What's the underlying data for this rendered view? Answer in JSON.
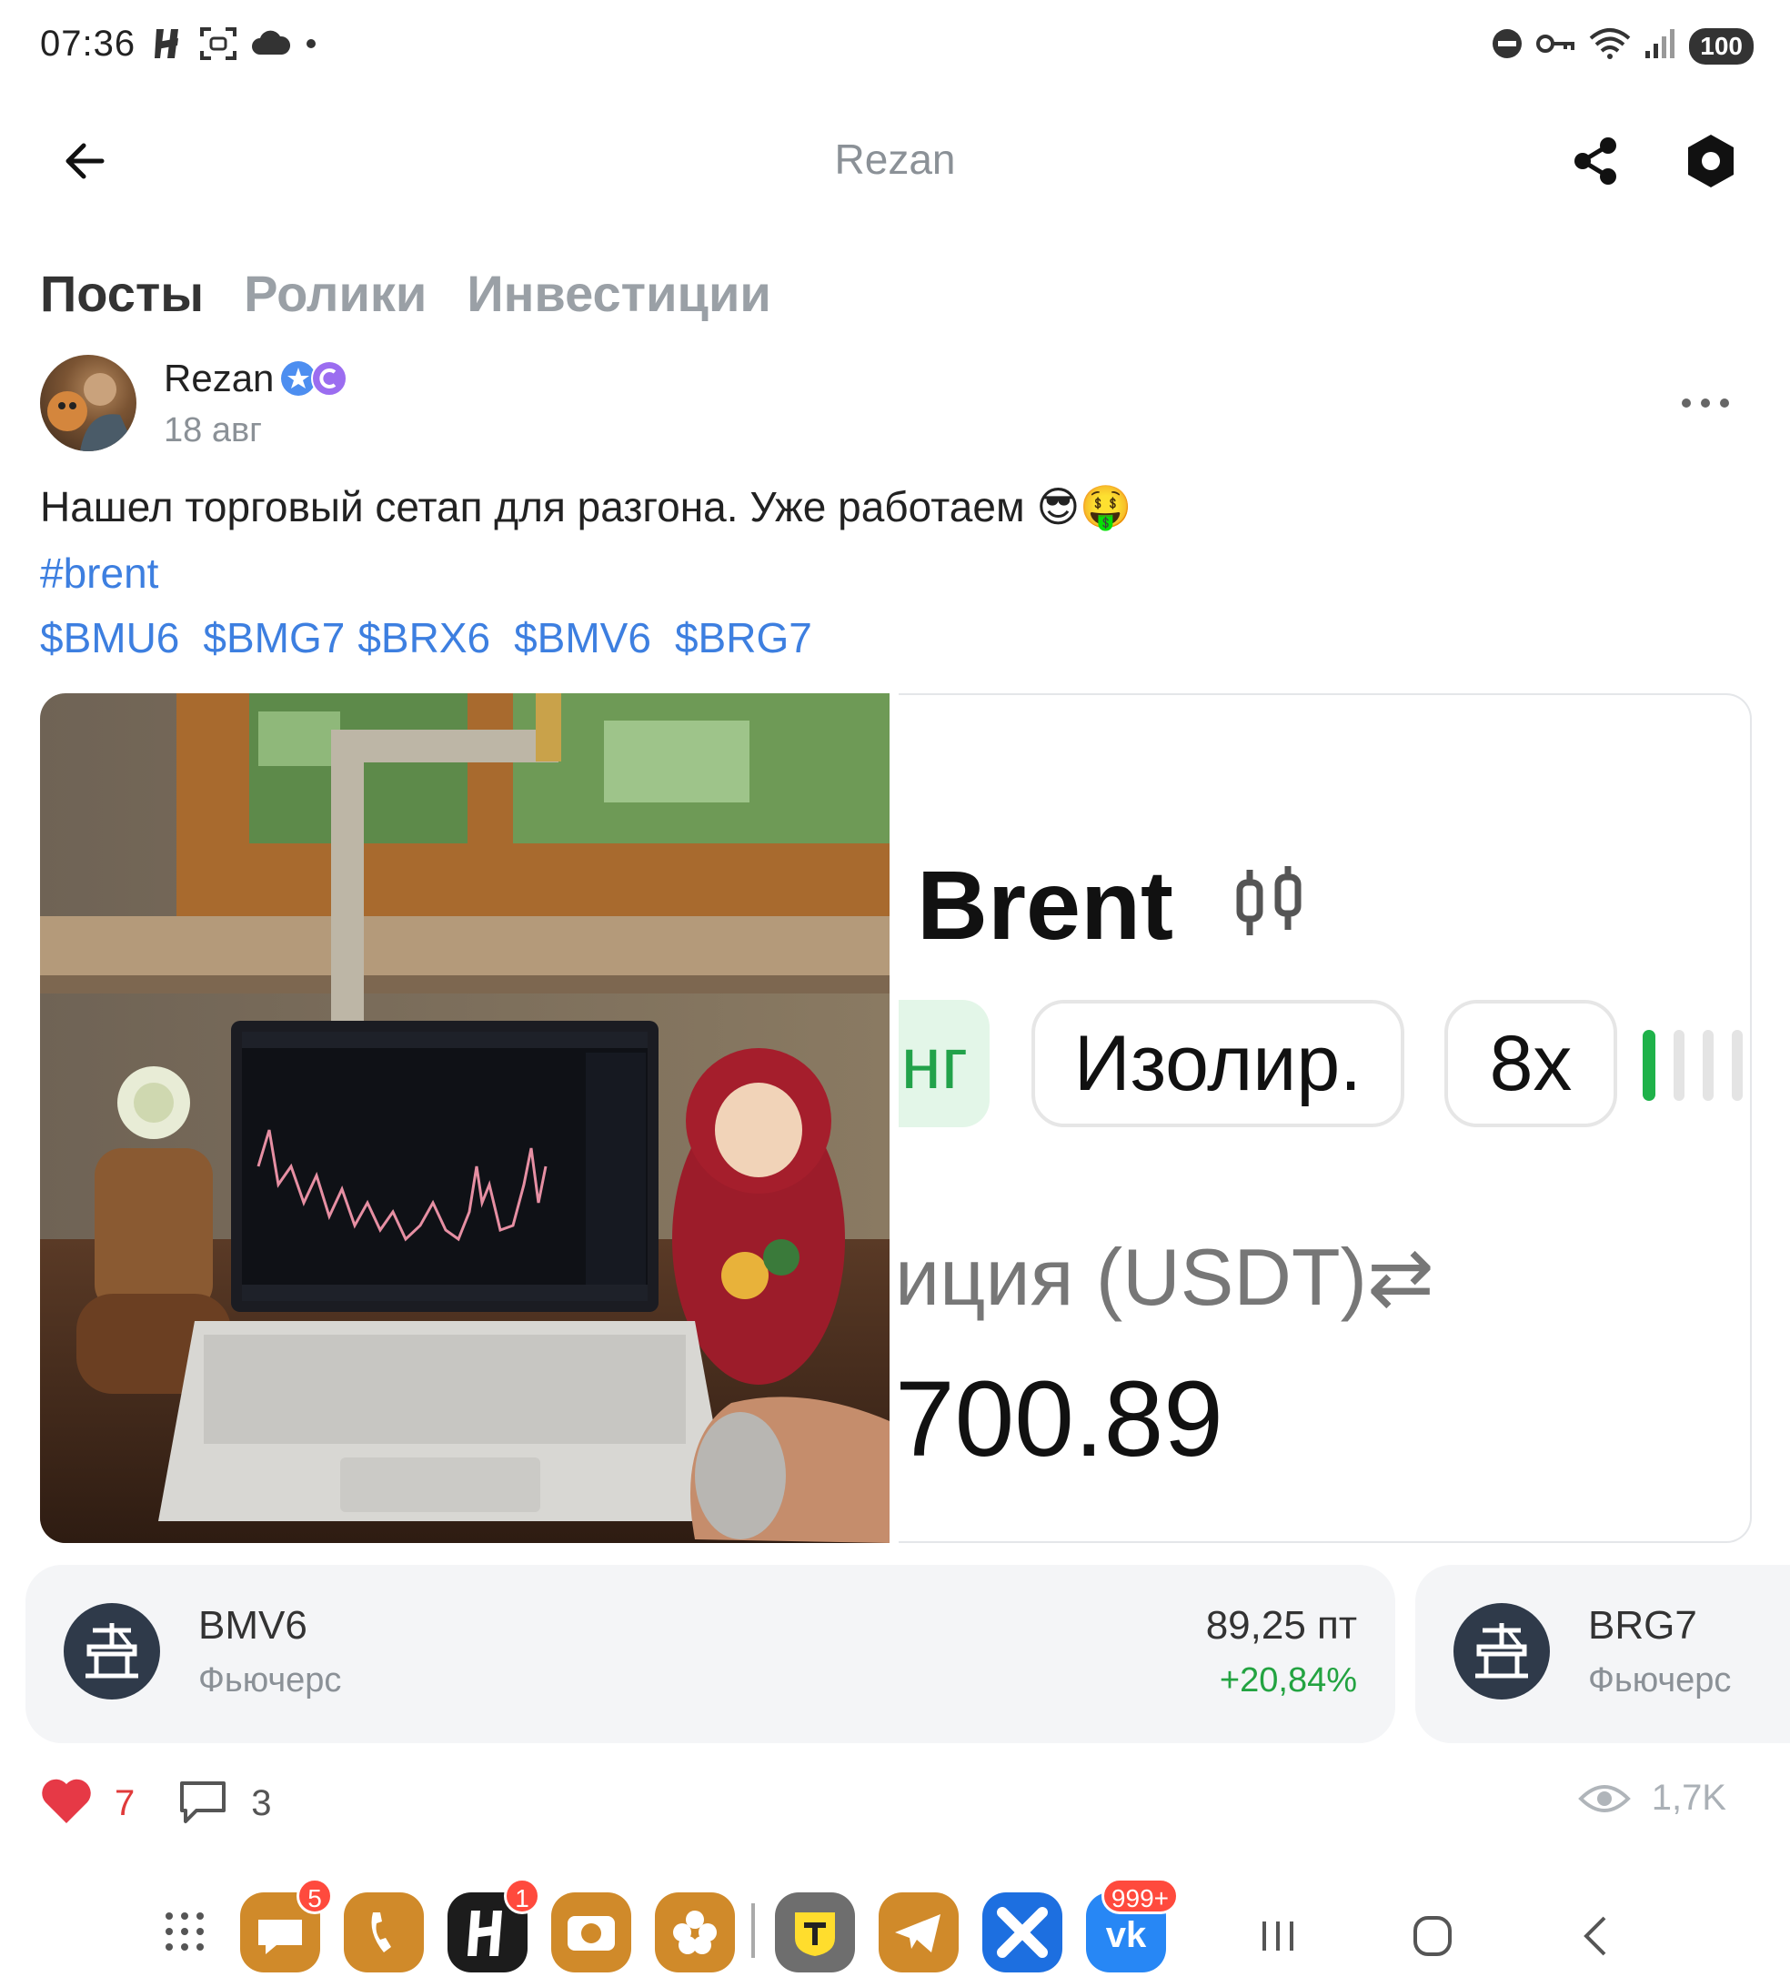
{
  "status_bar": {
    "time": "07:36",
    "battery": "100",
    "left_icons": [
      "hydra-icon",
      "screenshot-icon",
      "cloud-icon",
      "dot-icon"
    ],
    "right_icons": [
      "dnd-icon",
      "key-icon",
      "wifi-icon",
      "signal-icon"
    ]
  },
  "header": {
    "title": "Rezan"
  },
  "tabs": [
    {
      "label": "Посты",
      "active": true
    },
    {
      "label": "Ролики",
      "active": false
    },
    {
      "label": "Инвестиции",
      "active": false
    }
  ],
  "post": {
    "author": "Rezan",
    "date": "18 авг",
    "text": "Нашел торговый сетап для разгона. Уже работаем 😎🤑",
    "hashtag": "#brent",
    "tickers": [
      "$BMU6",
      "$BMG7",
      "$BRX6",
      "$BMV6",
      "$BRG7"
    ],
    "image_right": {
      "title": "Brent",
      "chip_partial": "нг",
      "chip_margin": "Изолир.",
      "chip_leverage": "8x",
      "label": "иция (USDT)⇄",
      "value": "700.89"
    }
  },
  "instruments": [
    {
      "ticker": "BMV6",
      "type": "Фьючерс",
      "price": "89,25 пт",
      "change": "+20,84%"
    },
    {
      "ticker": "BRG7",
      "type": "Фьючерс"
    }
  ],
  "actions": {
    "likes": "7",
    "comments": "3",
    "views": "1,7K"
  },
  "dock": {
    "badges": {
      "messages": "5",
      "hydra": "1",
      "vk": "999+"
    }
  },
  "colors": {
    "link": "#3d7fe0",
    "positive": "#23a341",
    "like": "#e03a3a"
  }
}
